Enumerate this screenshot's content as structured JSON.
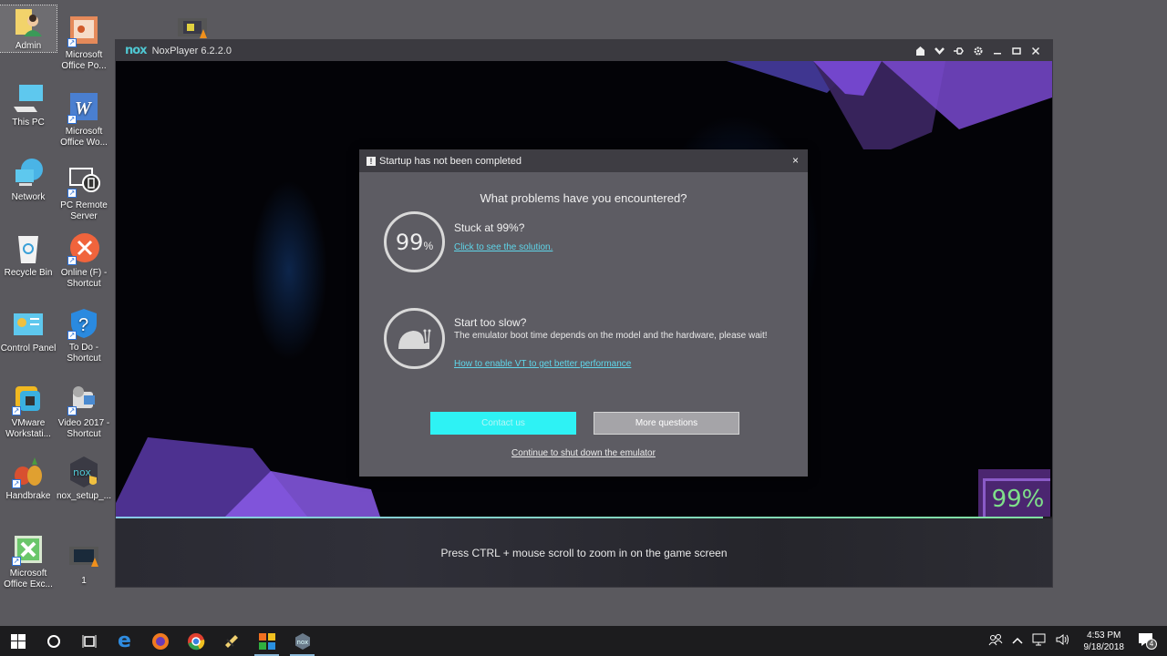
{
  "desktop": {
    "icons": [
      {
        "label": "Admin",
        "icon": "user-folder-icon"
      },
      {
        "label": "Microsoft Office Po...",
        "icon": "powerpoint-icon"
      },
      {
        "label": "This PC",
        "icon": "computer-icon"
      },
      {
        "label": "Microsoft Office Wo...",
        "icon": "word-icon"
      },
      {
        "label": "Network",
        "icon": "network-icon"
      },
      {
        "label": "PC Remote Server",
        "icon": "remote-server-icon"
      },
      {
        "label": "Recycle Bin",
        "icon": "recycle-bin-icon"
      },
      {
        "label": "Online (F) - Shortcut",
        "icon": "error-x-icon"
      },
      {
        "label": "Control Panel",
        "icon": "control-panel-icon"
      },
      {
        "label": "To Do - Shortcut",
        "icon": "help-shield-icon"
      },
      {
        "label": "VMware Workstati...",
        "icon": "vmware-icon"
      },
      {
        "label": "Video 2017 - Shortcut",
        "icon": "camcorder-icon"
      },
      {
        "label": "Handbrake",
        "icon": "handbrake-icon"
      },
      {
        "label": "nox_setup_...",
        "icon": "nox-setup-icon"
      },
      {
        "label": "Microsoft Office Exc...",
        "icon": "excel-icon"
      },
      {
        "label": "1",
        "icon": "video-file-icon"
      }
    ]
  },
  "nox": {
    "logo": "nox",
    "title": "NoxPlayer 6.2.2.0",
    "controls": [
      "home-icon",
      "chevron-down-icon",
      "pin-icon",
      "gear-icon",
      "minimize-icon",
      "maximize-icon",
      "close-icon"
    ],
    "progress_percent": "99%",
    "progress_value": 0.99,
    "bottom_hint": "Press CTRL + mouse scroll to zoom in on the game screen"
  },
  "dialog": {
    "title": "Startup has not been completed",
    "warn_glyph": "!",
    "close_glyph": "×",
    "question": "What problems have you encountered?",
    "problem1": {
      "badge_number": "99",
      "badge_unit": "%",
      "title": "Stuck at 99%?",
      "link": "Click to see the solution."
    },
    "problem2": {
      "title": "Start too slow?",
      "desc": "The emulator boot time depends on the model and the hardware, please wait!",
      "link": "How to enable VT to get better performance"
    },
    "contact_button": "Contact us",
    "more_button": "More questions",
    "shutdown_link": "Continue to shut down the emulator",
    "colors": {
      "accent": "#2ef2f4",
      "link": "#5fd6ea"
    }
  },
  "taskbar": {
    "items": [
      "windows-start-icon",
      "cortana-icon",
      "task-view-icon",
      "edge-icon",
      "firefox-icon",
      "chrome-icon",
      "winamp-icon",
      "tiles-app-icon",
      "nox-icon"
    ],
    "tray": {
      "people": "ጸ",
      "chevron": "^",
      "time": "4:53 PM",
      "date": "9/18/2018",
      "notifications": "4"
    }
  }
}
